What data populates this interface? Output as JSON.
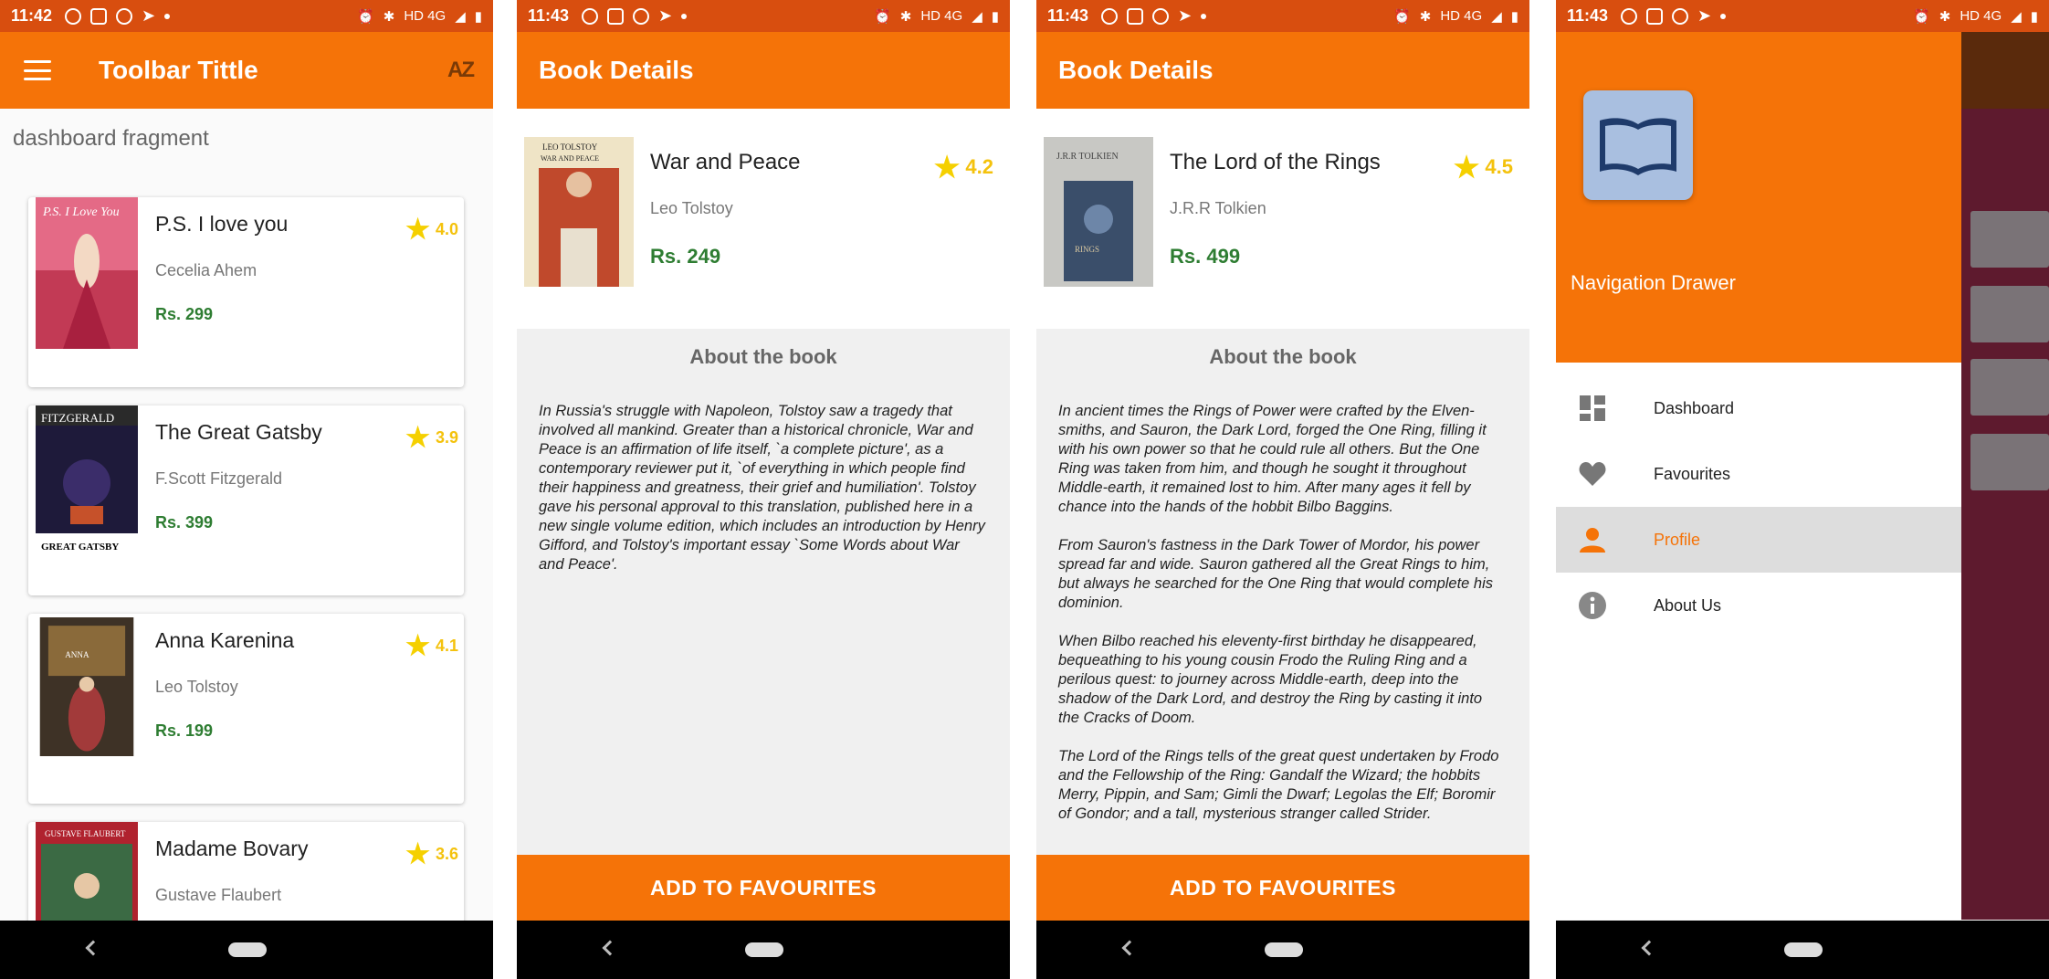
{
  "status": {
    "screen1_time": "11:42",
    "screen2_time": "11:43",
    "screen3_time": "11:43",
    "screen4_time": "11:43",
    "network": "HD 4G"
  },
  "screen1": {
    "toolbar_title": "Toolbar Tittle",
    "sort_icon": "AZ",
    "fragment_label": "dashboard fragment",
    "books": [
      {
        "title": "P.S. I love you",
        "author": "Cecelia Ahem",
        "price": "Rs. 299",
        "rating": "4.0"
      },
      {
        "title": "The Great Gatsby",
        "author": "F.Scott Fitzgerald",
        "price": "Rs. 399",
        "rating": "3.9"
      },
      {
        "title": "Anna Karenina",
        "author": "Leo Tolstoy",
        "price": "Rs. 199",
        "rating": "4.1"
      },
      {
        "title": "Madame Bovary",
        "author": "Gustave Flaubert",
        "price": "",
        "rating": "3.6"
      }
    ]
  },
  "screen2": {
    "toolbar_title": "Book Details",
    "book": {
      "title": "War and Peace",
      "author": "Leo Tolstoy",
      "price": "Rs. 249",
      "rating": "4.2"
    },
    "about_title": "About the book",
    "about_text": "In Russia's struggle with Napoleon, Tolstoy saw a tragedy that involved all mankind. Greater than a historical chronicle, War and Peace is an affirmation of life itself, `a complete picture', as a contemporary reviewer put it, `of everything in which people find their happiness and greatness, their grief and humiliation'. Tolstoy gave his personal approval to this translation, published here in a new single volume edition, which includes an introduction by Henry Gifford, and Tolstoy's important essay `Some Words about War and Peace'.",
    "button_label": "ADD TO FAVOURITES"
  },
  "screen3": {
    "toolbar_title": "Book Details",
    "book": {
      "title": "The Lord of the Rings",
      "author": "J.R.R Tolkien",
      "price": "Rs. 499",
      "rating": "4.5"
    },
    "about_title": "About the book",
    "about_text": "In ancient times the Rings of Power were crafted by the Elven-smiths, and Sauron, the Dark Lord, forged the One Ring, filling it with his own power so that he could rule all others. But the One Ring was taken from him, and though he sought it throughout Middle-earth, it remained lost to him. After many ages it fell by chance into the hands of the hobbit Bilbo Baggins.\n\nFrom Sauron's fastness in the Dark Tower of Mordor, his power spread far and wide. Sauron gathered all the Great Rings to him, but always he searched for the One Ring that would complete his dominion.\n\nWhen Bilbo reached his eleventy-first birthday he disappeared, bequeathing to his young cousin Frodo the Ruling Ring and a perilous quest: to journey across Middle-earth, deep into the shadow of the Dark Lord, and destroy the Ring by casting it into the Cracks of Doom.\n\nThe Lord of the Rings tells of the great quest undertaken by Frodo and the Fellowship of the Ring: Gandalf the Wizard; the hobbits Merry, Pippin, and Sam; Gimli the Dwarf; Legolas the Elf; Boromir of Gondor; and a tall, mysterious stranger called Strider.",
    "button_label": "ADD TO FAVOURITES"
  },
  "screen4": {
    "drawer_title": "Navigation Drawer",
    "menu": [
      {
        "label": "Dashboard",
        "icon": "dashboard-icon"
      },
      {
        "label": "Favourites",
        "icon": "heart-icon"
      },
      {
        "label": "Profile",
        "icon": "person-icon",
        "selected": true
      },
      {
        "label": "About Us",
        "icon": "info-icon"
      }
    ]
  },
  "colors": {
    "primary": "#f57308",
    "status_bar": "#d84e0f",
    "price": "#2e7d32",
    "star": "#f5d000"
  }
}
